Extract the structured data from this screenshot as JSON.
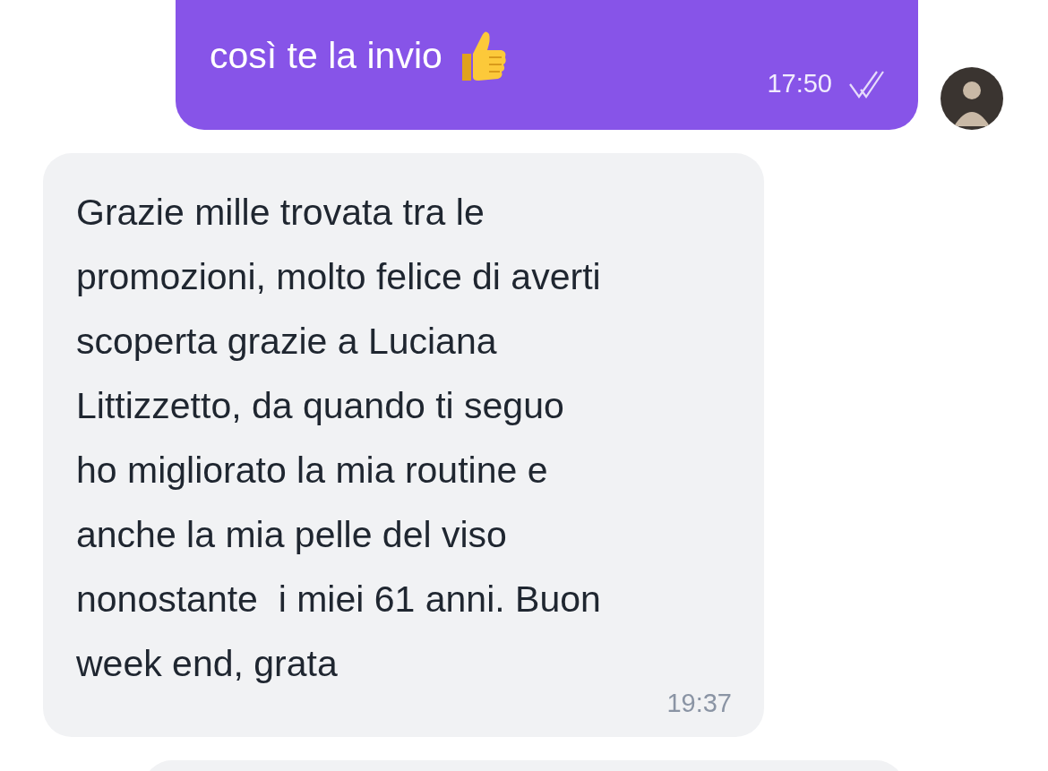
{
  "messages": [
    {
      "kind": "outgoing",
      "text": "così te la invio",
      "time": "17:50",
      "read": true
    },
    {
      "kind": "incoming",
      "text": "Grazie mille trovata tra le\npromozioni, molto felice di averti\nscoperta grazie a Luciana\nLittizzetto, da quando ti seguo\nho migliorato la mia routine e\nanche la mia pelle del viso\nnonostante  i miei 61 anni. Buon\nweek end, grata",
      "time": "19:37"
    },
    {
      "kind": "incoming-partial"
    }
  ]
}
